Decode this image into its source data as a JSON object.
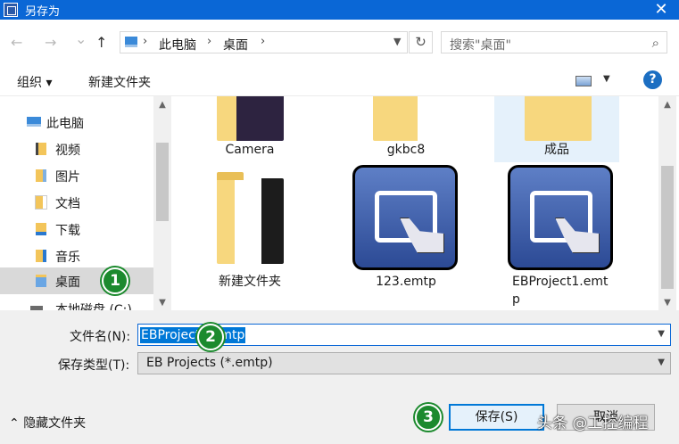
{
  "window": {
    "title": "另存为",
    "close_glyph": "✕"
  },
  "nav": {
    "back_glyph": "←",
    "forward_glyph": "→",
    "recent_glyph": "⌄",
    "up_glyph": "↑",
    "breadcrumb": [
      "此电脑",
      "桌面"
    ],
    "breadcrumb_sep": "›",
    "refresh_glyph": "↻",
    "search_placeholder": "搜索\"桌面\"",
    "search_glyph": "⌕"
  },
  "toolbar": {
    "organize_label": "组织 ▾",
    "new_folder_label": "新建文件夹",
    "help_label": "?"
  },
  "sidebar": {
    "items": [
      {
        "label": "此电脑",
        "icon": "computer-icon"
      },
      {
        "label": "视频",
        "icon": "videos-folder-icon"
      },
      {
        "label": "图片",
        "icon": "pictures-folder-icon"
      },
      {
        "label": "文档",
        "icon": "documents-folder-icon"
      },
      {
        "label": "下载",
        "icon": "downloads-folder-icon"
      },
      {
        "label": "音乐",
        "icon": "music-folder-icon"
      },
      {
        "label": "桌面",
        "icon": "desktop-folder-icon",
        "selected": true
      },
      {
        "label": "本地磁盘 (C:)",
        "icon": "drive-icon"
      }
    ]
  },
  "files": [
    {
      "name": "Camera",
      "icon": "folder-icon"
    },
    {
      "name": "gkbc8",
      "icon": "folder-icon"
    },
    {
      "name": "成品",
      "icon": "folder-icon",
      "highlighted": true
    },
    {
      "name": "新建文件夹",
      "icon": "folder-icon"
    },
    {
      "name": "123.emtp",
      "icon": "emtp-file-icon"
    },
    {
      "name_line1": "EBProject1.emt",
      "name_line2": "p",
      "icon": "emtp-file-icon"
    }
  ],
  "form": {
    "filename_label": "文件名(N):",
    "filename_value": "EBProject1.emtp",
    "filetype_label": "保存类型(T):",
    "filetype_value": "EB Projects (*.emtp)",
    "hide_folders_label": "隐藏文件夹",
    "save_label": "保存(S)",
    "cancel_label": "取消"
  },
  "annotations": {
    "badge1": "1",
    "badge2": "2",
    "badge3": "3"
  },
  "watermark": "头条 @工控编程",
  "colors": {
    "accent": "#0A67D6",
    "selection": "#0078D7",
    "badge": "#1C8A2E"
  }
}
